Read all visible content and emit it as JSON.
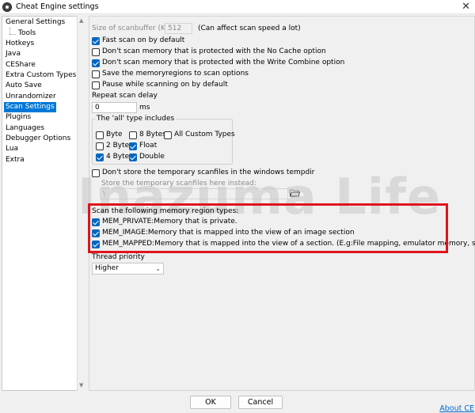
{
  "window": {
    "title": "Cheat Engine settings"
  },
  "tree": {
    "items": [
      {
        "label": "General Settings"
      },
      {
        "label": "Tools"
      },
      {
        "label": "Hotkeys"
      },
      {
        "label": "Java"
      },
      {
        "label": "CEShare"
      },
      {
        "label": "Extra Custom Types"
      },
      {
        "label": "Auto Save"
      },
      {
        "label": "Unrandomizer"
      },
      {
        "label": "Scan Settings"
      },
      {
        "label": "Plugins"
      },
      {
        "label": "Languages"
      },
      {
        "label": "Debugger Options"
      },
      {
        "label": "Lua"
      },
      {
        "label": "Extra"
      }
    ],
    "selected": "Scan Settings"
  },
  "scan": {
    "buffer_label": "Size of scanbuffer (KB) :",
    "buffer_value": "512",
    "buffer_hint": "(Can affect scan speed a lot)",
    "fast_scan": "Fast scan on by default",
    "no_cache": "Don't scan memory that is protected with the No Cache option",
    "write_combine": "Don't scan memory that is protected with the Write Combine option",
    "save_regions": "Save the memoryregions to scan options",
    "pause_scanning": "Pause while scanning on by default",
    "repeat_delay_label": "Repeat scan delay",
    "repeat_delay_value": "0",
    "repeat_delay_unit": "ms"
  },
  "all_types": {
    "title": "The 'all' type includes",
    "byte": "Byte",
    "bytes8": "8 Bytes",
    "custom": "All Custom Types",
    "bytes2": "2 Bytes",
    "float": "Float",
    "bytes4": "4 Bytes",
    "double": "Double"
  },
  "tempfiles": {
    "dont_store": "Don't store the temporary scanfiles in the windows tempdir",
    "store_here": "Store the temporary scanfiles here instead:",
    "path": "\\"
  },
  "regions": {
    "title": "Scan the following memory region types:",
    "private": "MEM_PRIVATE:Memory that is private.",
    "image": "MEM_IMAGE:Memory that is mapped into the view of an image section",
    "mapped": "MEM_MAPPED:Memory that is mapped into the view of a section. (E.g:File mapping, emulator memory, slow)"
  },
  "thread": {
    "label": "Thread priority",
    "value": "Higher"
  },
  "buttons": {
    "ok": "OK",
    "cancel": "Cancel",
    "about": "About CE"
  },
  "watermark": "Inazuma Life",
  "colors": {
    "accent": "#0067c0",
    "highlight_border": "#e0141c",
    "selected_bg": "#0078d7",
    "link": "#0066cc"
  },
  "icons": {
    "app": "cheat-engine-icon",
    "close": "close-icon",
    "folder": "folder-open-icon"
  }
}
